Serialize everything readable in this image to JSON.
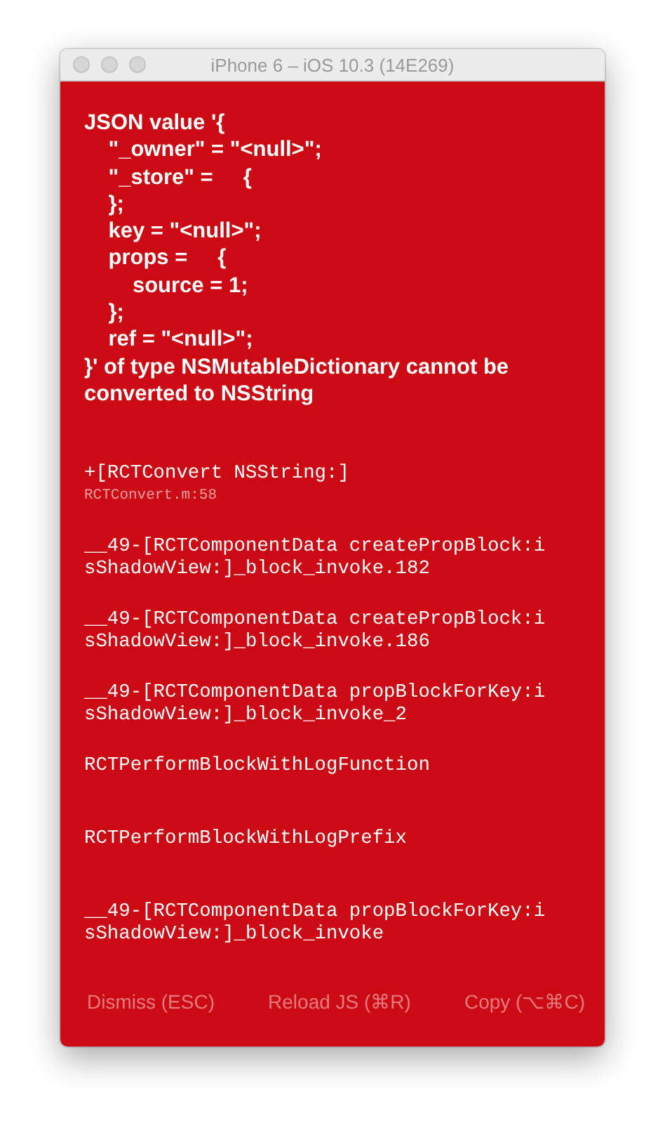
{
  "window": {
    "title": "iPhone 6 – iOS 10.3 (14E269)"
  },
  "error": {
    "message": "JSON value '{\n    \"_owner\" = \"<null>\";\n    \"_store\" =     {\n    };\n    key = \"<null>\";\n    props =     {\n        source = 1;\n    };\n    ref = \"<null>\";\n}' of type NSMutableDictionary cannot be converted to NSString",
    "stack": [
      {
        "method": "+[RCTConvert NSString:]",
        "file": "RCTConvert.m:58"
      },
      {
        "method": "__49-[RCTComponentData createPropBlock:isShadowView:]_block_invoke.182"
      },
      {
        "method": "__49-[RCTComponentData createPropBlock:isShadowView:]_block_invoke.186"
      },
      {
        "method": "__49-[RCTComponentData propBlockForKey:isShadowView:]_block_invoke_2"
      },
      {
        "method": "RCTPerformBlockWithLogFunction"
      },
      {
        "method": "RCTPerformBlockWithLogPrefix"
      },
      {
        "method": "__49-[RCTComponentData propBlockForKey:isShadowView:]_block_invoke"
      }
    ]
  },
  "buttons": [
    {
      "label": "Dismiss (ESC)"
    },
    {
      "label": "Reload JS (⌘R)"
    },
    {
      "label": "Copy (⌥⌘C)"
    }
  ]
}
